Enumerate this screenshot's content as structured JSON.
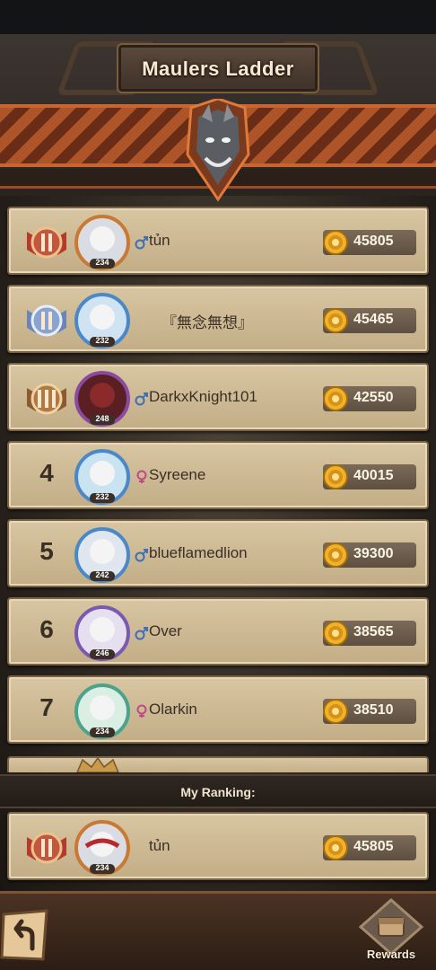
{
  "header": {
    "title": "Maulers Ladder"
  },
  "ranking": [
    {
      "rank": "1",
      "badge": "rank-1-badge",
      "level": "234",
      "gender": "male",
      "name": "tủn",
      "score": "45805"
    },
    {
      "rank": "2",
      "badge": "rank-2-badge",
      "level": "232",
      "gender": "none",
      "name": "『無念無想』",
      "score": "45465"
    },
    {
      "rank": "3",
      "badge": "rank-3-badge",
      "level": "248",
      "gender": "male",
      "name": "DarkxKnight101",
      "score": "42550"
    },
    {
      "rank": "4",
      "badge": "",
      "level": "232",
      "gender": "female",
      "name": "Syreene",
      "score": "40015"
    },
    {
      "rank": "5",
      "badge": "",
      "level": "242",
      "gender": "male",
      "name": "blueflamedlion",
      "score": "39300"
    },
    {
      "rank": "6",
      "badge": "",
      "level": "246",
      "gender": "male",
      "name": "Over",
      "score": "38565"
    },
    {
      "rank": "7",
      "badge": "",
      "level": "234",
      "gender": "female",
      "name": "Olarkin",
      "score": "38510"
    }
  ],
  "my_ranking": {
    "label": "My Ranking:",
    "level": "234",
    "name": "tủn",
    "score": "45805"
  },
  "bottom": {
    "rewards_label": "Rewards"
  },
  "colors": {
    "accent": "#d66a32",
    "card": "#d8c6a2",
    "male": "#3d6fb8",
    "female": "#c04a86"
  }
}
